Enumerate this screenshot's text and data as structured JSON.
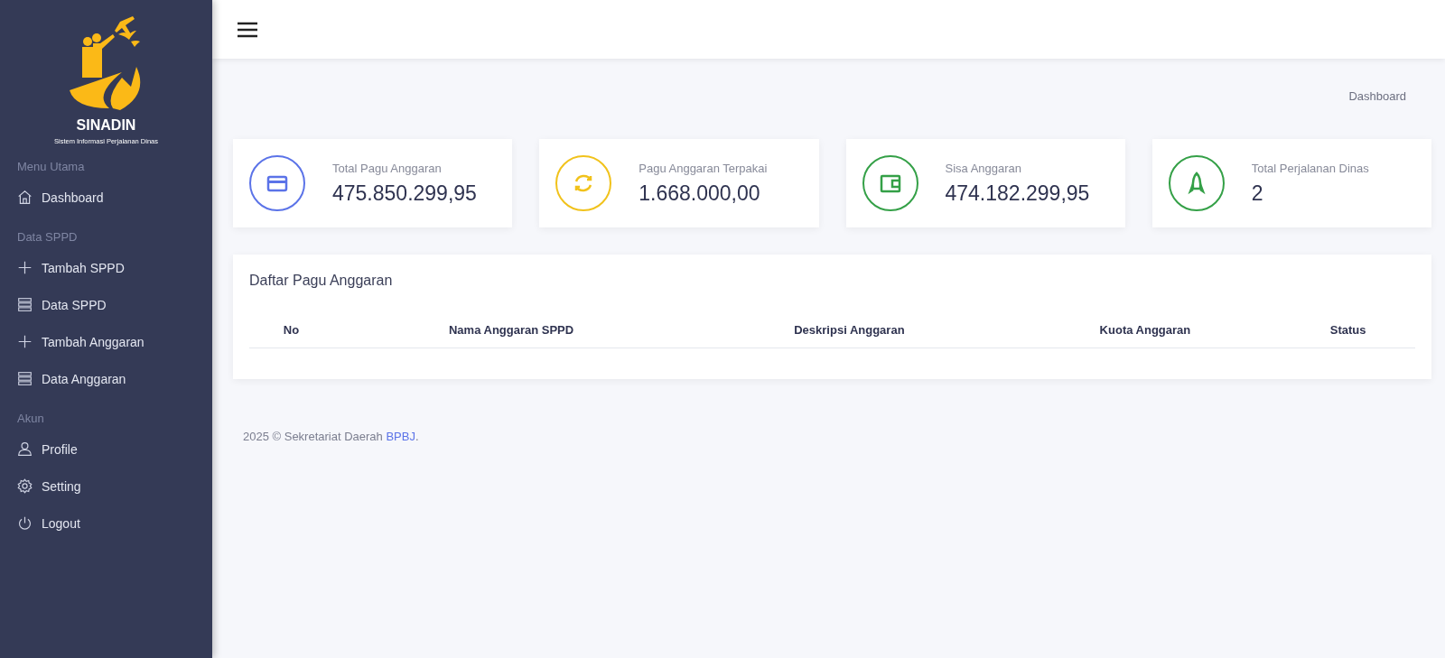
{
  "sidebar": {
    "brand": {
      "title": "SINADIN",
      "subtitle": "Sistem Informasi Perjalanan Dinas"
    },
    "sections": [
      {
        "heading": "Menu Utama",
        "items": [
          {
            "label": "Dashboard"
          }
        ]
      },
      {
        "heading": "Data SPPD",
        "items": [
          {
            "label": "Tambah SPPD"
          },
          {
            "label": "Data SPPD"
          },
          {
            "label": "Tambah Anggaran"
          },
          {
            "label": "Data Anggaran"
          }
        ]
      },
      {
        "heading": "Akun",
        "items": [
          {
            "label": "Profile"
          },
          {
            "label": "Setting"
          },
          {
            "label": "Logout"
          }
        ]
      }
    ]
  },
  "breadcrumb": "Dashboard",
  "stats": [
    {
      "label": "Total Pagu Anggaran",
      "value": "475.850.299,95",
      "color": "#5b73e8"
    },
    {
      "label": "Pagu Anggaran Terpakai",
      "value": "1.668.000,00",
      "color": "#f1c21b"
    },
    {
      "label": "Sisa Anggaran",
      "value": "474.182.299,95",
      "color": "#34a047"
    },
    {
      "label": "Total Perjalanan Dinas",
      "value": "2",
      "color": "#34a047"
    }
  ],
  "table": {
    "title": "Daftar Pagu Anggaran",
    "columns": [
      "No",
      "Nama Anggaran SPPD",
      "Deskripsi Anggaran",
      "Kuota Anggaran",
      "Status"
    ]
  },
  "footer": {
    "text": "2025 © Sekretariat Daerah ",
    "link": "BPBJ",
    "end": "."
  }
}
